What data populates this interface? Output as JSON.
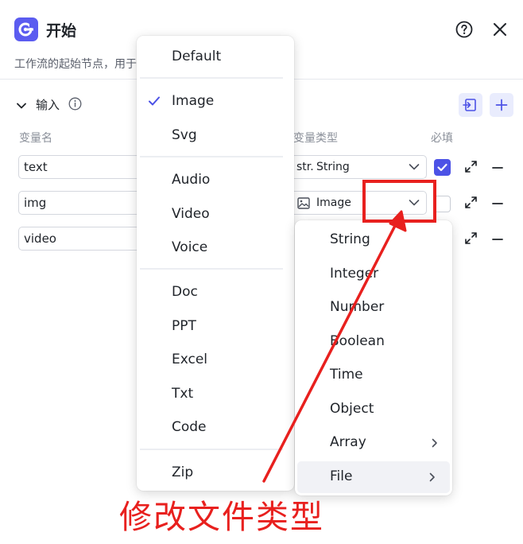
{
  "header": {
    "title": "开始",
    "description": "工作流的起始节点，用于"
  },
  "section": {
    "title": "输入"
  },
  "columns": {
    "name": "变量名",
    "type": "变量类型",
    "required": "必填"
  },
  "rows": [
    {
      "name": "text",
      "type_prefix": "str.",
      "type": "String",
      "required": true
    },
    {
      "name": "img",
      "type": "Image",
      "required": false
    },
    {
      "name": "video"
    }
  ],
  "file_type_menu": {
    "groups": [
      [
        "Default"
      ],
      [
        "Image",
        "Svg"
      ],
      [
        "Audio",
        "Video",
        "Voice"
      ],
      [
        "Doc",
        "PPT",
        "Excel",
        "Txt",
        "Code"
      ],
      [
        "Zip"
      ]
    ],
    "selected": "Image"
  },
  "variable_type_menu": {
    "items": [
      "String",
      "Integer",
      "Number",
      "Boolean",
      "Time",
      "Object",
      "Array",
      "File"
    ],
    "with_submenu": [
      "Array",
      "File"
    ],
    "hovered": "File"
  },
  "annotation": {
    "text": "修改文件类型",
    "color": "#e8201e"
  },
  "colors": {
    "accent": "#4c52e6",
    "icon_bg": "#5b5cf0",
    "button_bg": "#e9ecfd"
  }
}
